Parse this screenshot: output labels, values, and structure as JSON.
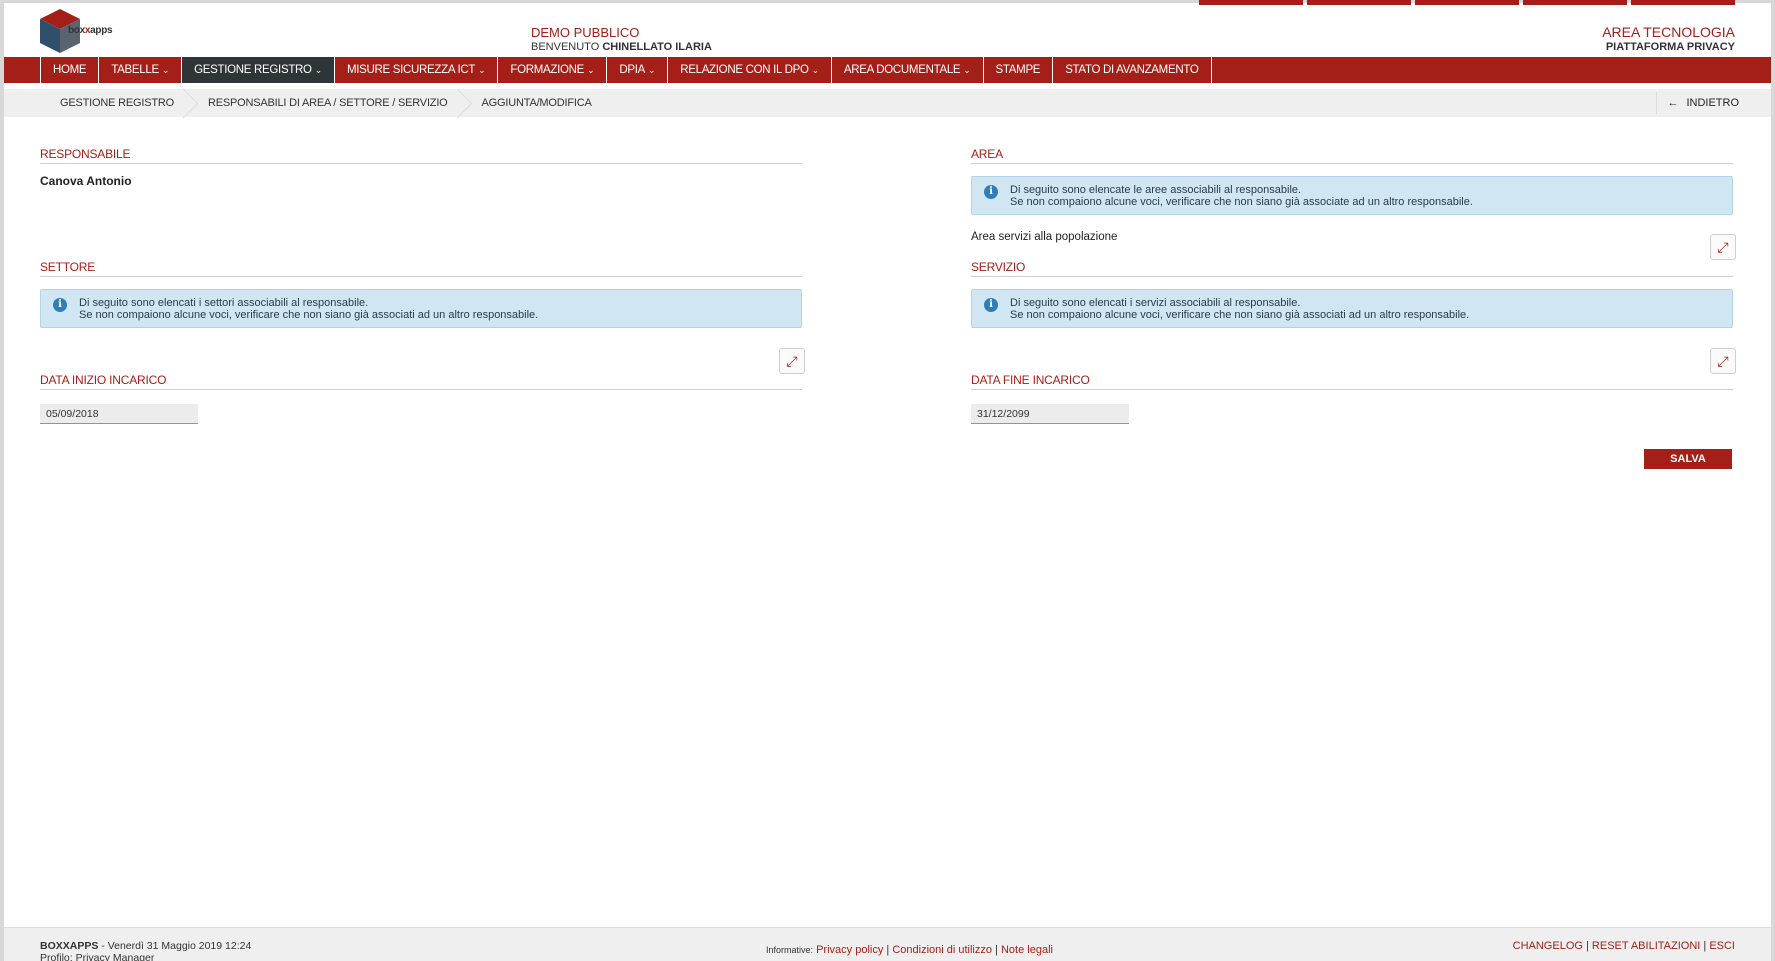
{
  "header": {
    "logo_text_a": "box",
    "logo_text_b": "x",
    "logo_text_c": "apps",
    "demo": "DEMO PUBBLICO",
    "welcome_prefix": "BENVENUTO",
    "welcome_user": "CHINELLATO ILARIA",
    "area": "AREA TECNOLOGIA",
    "platform": "PIATTAFORMA PRIVACY"
  },
  "nav": [
    {
      "label": "HOME",
      "dropdown": false
    },
    {
      "label": "TABELLE",
      "dropdown": true
    },
    {
      "label": "GESTIONE REGISTRO",
      "dropdown": true,
      "active": true
    },
    {
      "label": "MISURE SICUREZZA ICT",
      "dropdown": true
    },
    {
      "label": "FORMAZIONE",
      "dropdown": true
    },
    {
      "label": "DPIA",
      "dropdown": true
    },
    {
      "label": "RELAZIONE CON IL DPO",
      "dropdown": true
    },
    {
      "label": "AREA DOCUMENTALE",
      "dropdown": true
    },
    {
      "label": "STAMPE",
      "dropdown": false
    },
    {
      "label": "STATO DI AVANZAMENTO",
      "dropdown": false
    }
  ],
  "breadcrumb": [
    "GESTIONE REGISTRO",
    "RESPONSABILI DI AREA / SETTORE / SERVIZIO",
    "AGGIUNTA/MODIFICA"
  ],
  "back_label": "INDIETRO",
  "responsabile": {
    "title": "RESPONSABILE",
    "value": "Canova Antonio"
  },
  "area": {
    "title": "AREA",
    "info_line1": "Di seguito sono elencate le aree associabili al responsabile.",
    "info_line2": "Se non compaiono alcune voci, verificare che non siano già associate ad un altro responsabile.",
    "value": "Area servizi alla popolazione"
  },
  "settore": {
    "title": "SETTORE",
    "info_line1": "Di seguito sono elencati i settori associabili al responsabile.",
    "info_line2": "Se non compaiono alcune voci, verificare che non siano già associati ad un altro responsabile."
  },
  "servizio": {
    "title": "SERVIZIO",
    "info_line1": "Di seguito sono elencati i servizi associabili al responsabile.",
    "info_line2": "Se non compaiono alcune voci, verificare che non siano già associati ad un altro responsabile."
  },
  "data_inizio": {
    "title": "DATA INIZIO INCARICO",
    "value": "05/09/2018"
  },
  "data_fine": {
    "title": "DATA FINE INCARICO",
    "value": "31/12/2099"
  },
  "save_label": "SALVA",
  "footer": {
    "brand": "BOXXAPPS",
    "date": " - Venerdì 31 Maggio 2019 12:24",
    "profile": "Profilo: Privacy Manager",
    "informative": "Informative:",
    "privacy": "Privacy policy",
    "conditions": "Condizioni di utilizzo",
    "legal": "Note legali",
    "changelog": "CHANGELOG",
    "reset": "RESET ABILITAZIONI",
    "exit": "ESCI"
  },
  "colors": {
    "brand": "#a31f17",
    "active_nav": "#2e3538",
    "info_bg": "#d0e7f3"
  }
}
